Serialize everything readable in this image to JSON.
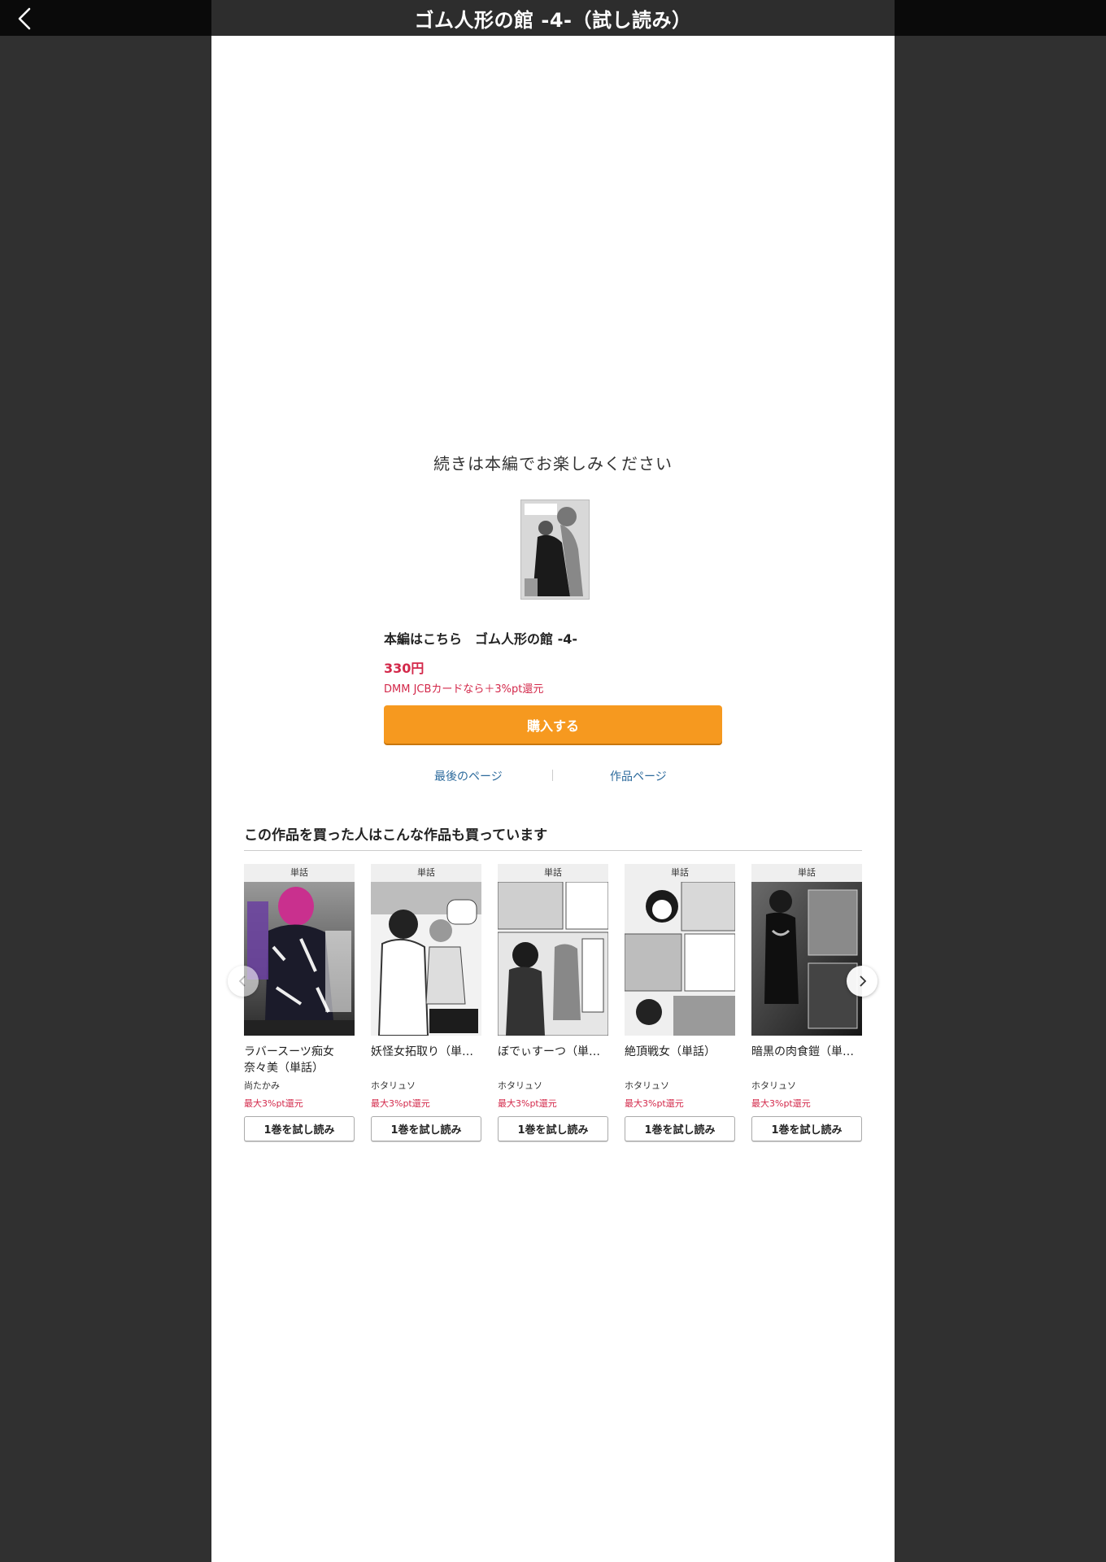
{
  "header": {
    "title": "ゴム人形の館 -4-（試し読み）",
    "back_icon": "chevron-left-icon"
  },
  "end_panel": {
    "message": "続きは本編でお楽しみください",
    "main_title": "本編はこちら　ゴム人形の館 -4-",
    "price": "330円",
    "jcb_note": "DMM JCBカードなら＋3%pt還元",
    "buy_label": "購入する",
    "last_page_label": "最後のページ",
    "work_page_label": "作品ページ"
  },
  "recommendations": {
    "heading": "この作品を買った人はこんな作品も買っています",
    "items": [
      {
        "label": "単話",
        "title": "ラバースーツ痴女\n奈々美（単話）",
        "author": "尚たかみ",
        "points": "最大3%pt還元",
        "button": "1巻を試し読み"
      },
      {
        "label": "単話",
        "title": "妖怪女拓取り（単…",
        "author": "ホタリュソ",
        "points": "最大3%pt還元",
        "button": "1巻を試し読み"
      },
      {
        "label": "単話",
        "title": "ぼでぃすーつ（単…",
        "author": "ホタリュソ",
        "points": "最大3%pt還元",
        "button": "1巻を試し読み"
      },
      {
        "label": "単話",
        "title": "絶頂戦女（単話）",
        "author": "ホタリュソ",
        "points": "最大3%pt還元",
        "button": "1巻を試し読み"
      },
      {
        "label": "単話",
        "title": "暗黒の肉食鎧（単…",
        "author": "ホタリュソ",
        "points": "最大3%pt還元",
        "button": "1巻を試し読み"
      }
    ]
  },
  "colors": {
    "accent_orange": "#f6991f",
    "price_red": "#d3284a",
    "link_blue": "#2c6a9c"
  }
}
